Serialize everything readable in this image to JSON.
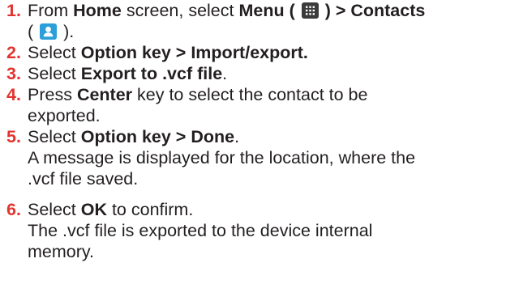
{
  "steps": [
    {
      "number": "1.",
      "t1": "From ",
      "home": "Home",
      "t2": " screen, select ",
      "menu": "Menu",
      "t3": " ( ",
      "t4": " ) > Contacts",
      "t5": "(",
      "t6": ").",
      "icons": [
        "menu-grid-icon",
        "contacts-person-icon"
      ]
    },
    {
      "number": "2.",
      "t1": "Select ",
      "bold": "Option key > Import/export."
    },
    {
      "number": "3.",
      "t1": "Select ",
      "bold": "Export to .vcf file",
      "t2": "."
    },
    {
      "number": "4.",
      "t1": "Press ",
      "bold": "Center",
      "t2": " key to select the contact to be",
      "t3": "exported."
    },
    {
      "number": "5.",
      "t1": "Select ",
      "bold": "Option key > Done",
      "t2": ".",
      "note1": "A message is displayed for the location, where the",
      "note2": ".vcf file saved."
    },
    {
      "number": "6.",
      "t1": "Select ",
      "bold": "OK",
      "t2": " to confirm.",
      "note1": "The .vcf file is exported to the device internal",
      "note2": "memory."
    }
  ],
  "colors": {
    "step_number": "#e2342f",
    "text": "#231f20",
    "menu_icon": "#3b3b3b",
    "contacts_icon": "#2a9fd9"
  }
}
